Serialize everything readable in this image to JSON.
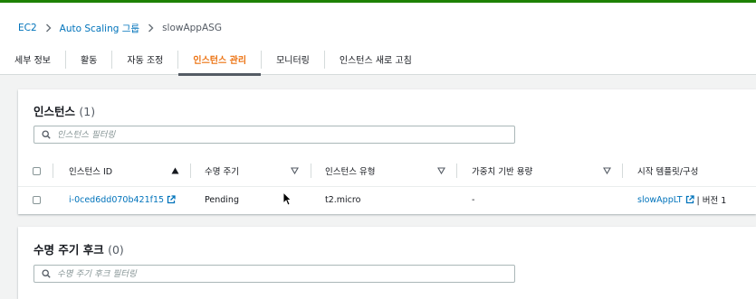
{
  "breadcrumb": {
    "items": [
      "EC2",
      "Auto Scaling 그룹"
    ],
    "current": "slowAppASG"
  },
  "tabs": [
    {
      "label": "세부 정보",
      "active": false
    },
    {
      "label": "활동",
      "active": false
    },
    {
      "label": "자동 조정",
      "active": false
    },
    {
      "label": "인스턴스 관리",
      "active": true
    },
    {
      "label": "모니터링",
      "active": false
    },
    {
      "label": "인스턴스 새로 고침",
      "active": false
    }
  ],
  "instances": {
    "title": "인스턴스",
    "count": "(1)",
    "filter_placeholder": "인스턴스 필터링",
    "columns": [
      "인스턴스 ID",
      "수명 주기",
      "인스턴스 유형",
      "가중치 기반 용량",
      "시작 템플릿/구성"
    ],
    "rows": [
      {
        "id": "i-0ced6dd070b421f15",
        "lifecycle": "Pending",
        "type": "t2.micro",
        "weight": "-",
        "template": "slowAppLT",
        "version": "| 버전 1"
      }
    ]
  },
  "hooks": {
    "title": "수명 주기 후크",
    "count": "(0)",
    "filter_placeholder": "수명 주기 후크 필터링"
  },
  "colors": {
    "accent": "#ec7211",
    "link": "#0073bb",
    "top_line": "#1d8102"
  }
}
